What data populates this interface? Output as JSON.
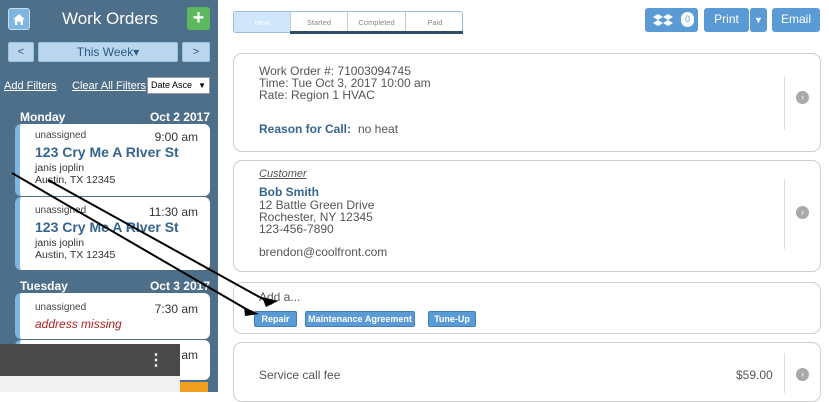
{
  "sidebar": {
    "title": "Work Orders",
    "add_label": "+",
    "prev_label": "<",
    "next_label": ">",
    "week_label": "This Week▾",
    "add_filters": "Add Filters",
    "clear_filters": "Clear All Filters",
    "sort_value": "Date Asce",
    "days": [
      {
        "day": "Monday",
        "date": "Oct 2 2017",
        "cards": [
          {
            "status": "unassigned",
            "time": "9:00 am",
            "address": "123 Cry Me A RIver St",
            "name": "janis joplin",
            "city": "Austin, TX 12345"
          },
          {
            "status": "unassigned",
            "time": "11:30 am",
            "address": "123 Cry Me A RIver St",
            "name": "janis joplin",
            "city": "Austin, TX 12345"
          }
        ]
      },
      {
        "day": "Tuesday",
        "date": "Oct 3 2017",
        "cards": [
          {
            "status": "unassigned",
            "time": "7:30 am",
            "missing": "address missing"
          },
          {
            "time": "am"
          }
        ]
      }
    ]
  },
  "overlay": {
    "menu_icon": "⋮"
  },
  "tabs": [
    "New",
    "Started",
    "Completed",
    "Paid"
  ],
  "toolbar": {
    "count": "0",
    "print": "Print",
    "email": "Email"
  },
  "order": {
    "number": "Work Order #: 71003094745",
    "time": "Time: Tue Oct 3, 2017 10:00 am",
    "rate": "Rate: Region 1 HVAC",
    "reason_label": "Reason for Call:",
    "reason_value": "no heat"
  },
  "customer": {
    "heading": "Customer",
    "name": "Bob Smith",
    "street": "12 Battle Green Drive",
    "city": "Rochester, NY 12345",
    "phone": "123-456-7890",
    "email": "brendon@coolfront.com"
  },
  "add": {
    "label": "Add a...",
    "buttons": [
      "Repair",
      "Maintenance Agreement",
      "Tune-Up"
    ]
  },
  "fee": {
    "label": "Service call fee",
    "amount": "$59.00"
  },
  "colors": {
    "sidebar": "#4e6f89",
    "accent": "#5b9bd5",
    "add_green": "#5cb85c",
    "tab_underline": "#2d4d68",
    "missing_red": "#b22222"
  }
}
